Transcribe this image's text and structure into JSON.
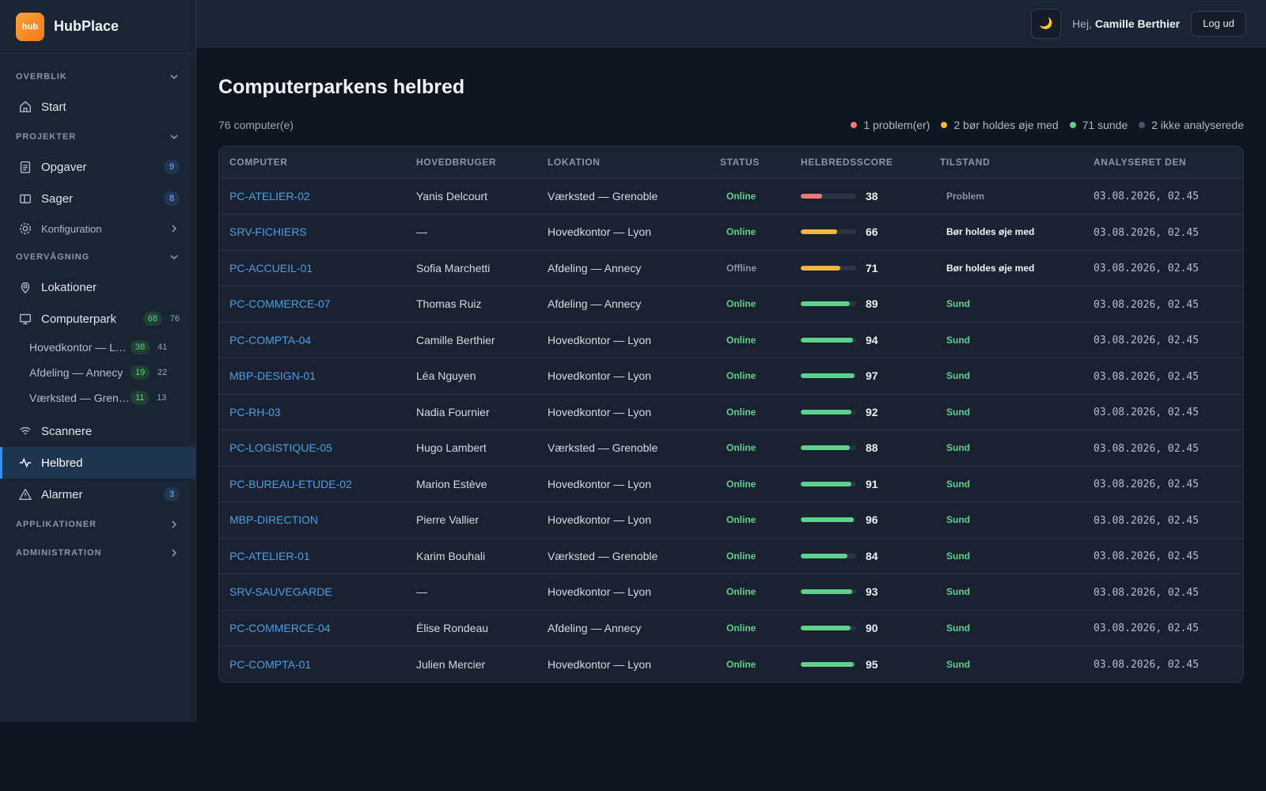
{
  "brand": {
    "logo_text": "hub",
    "name": "HubPlace"
  },
  "sidebar": {
    "sections": {
      "overblik": "OVERBLIK",
      "projekter": "PROJEKTER",
      "overvaagning": "OVERVÅGNING",
      "applikationer": "APPLIKATIONER",
      "administration": "ADMINISTRATION"
    },
    "start": "Start",
    "opgaver": {
      "label": "Opgaver",
      "badge": "9"
    },
    "sager": {
      "label": "Sager",
      "badge": "8"
    },
    "konfiguration": "Konfiguration",
    "lokationer": "Lokationer",
    "computerpark": {
      "label": "Computerpark",
      "badge": "68",
      "count": "76"
    },
    "sub": [
      {
        "label": "Hovedkontor — Lyon",
        "badge": "38",
        "count": "41"
      },
      {
        "label": "Afdeling — Annecy",
        "badge": "19",
        "count": "22"
      },
      {
        "label": "Værksted — Grenoble",
        "badge": "11",
        "count": "13"
      }
    ],
    "scannere": "Scannere",
    "helbred": "Helbred",
    "alarmer": {
      "label": "Alarmer",
      "badge": "3"
    }
  },
  "topbar": {
    "theme_glyph": "🌙",
    "greeting": "Hej,",
    "user": "Camille Berthier",
    "logout": "Log ud"
  },
  "page": {
    "title": "Computerparkens helbred",
    "total": "76 computer(e)",
    "legend": [
      {
        "label": "1 problem(er)",
        "color": "#f07a7a"
      },
      {
        "label": "2 bør holdes øje med",
        "color": "#f4b63f"
      },
      {
        "label": "71 sunde",
        "color": "#5fd18c"
      },
      {
        "label": "2 ikke analyserede",
        "color": "#4a5568"
      }
    ]
  },
  "table": {
    "headers": [
      "COMPUTER",
      "HOVEDBRUGER",
      "LOKATION",
      "STATUS",
      "HELBREDSSCORE",
      "TILSTAND",
      "ANALYSERET DEN"
    ],
    "colors": {
      "problem": "#f07a7a",
      "watch": "#f4b63f",
      "healthy": "#5fd18c"
    },
    "rows": [
      {
        "computer": "PC-ATELIER-02",
        "user": "Yanis Delcourt",
        "location": "Værksted — Grenoble",
        "status": "Online",
        "score": 38,
        "condition": "Problem",
        "level": "problem",
        "date": "03.08.2026, 02.45"
      },
      {
        "computer": "SRV-FICHIERS",
        "user": "—",
        "location": "Hovedkontor — Lyon",
        "status": "Online",
        "score": 66,
        "condition": "Bør holdes øje med",
        "level": "watch",
        "date": "03.08.2026, 02.45"
      },
      {
        "computer": "PC-ACCUEIL-01",
        "user": "Sofia Marchetti",
        "location": "Afdeling — Annecy",
        "status": "Offline",
        "score": 71,
        "condition": "Bør holdes øje med",
        "level": "watch",
        "date": "03.08.2026, 02.45"
      },
      {
        "computer": "PC-COMMERCE-07",
        "user": "Thomas Ruiz",
        "location": "Afdeling — Annecy",
        "status": "Online",
        "score": 89,
        "condition": "Sund",
        "level": "healthy",
        "date": "03.08.2026, 02.45"
      },
      {
        "computer": "PC-COMPTA-04",
        "user": "Camille Berthier",
        "location": "Hovedkontor — Lyon",
        "status": "Online",
        "score": 94,
        "condition": "Sund",
        "level": "healthy",
        "date": "03.08.2026, 02.45"
      },
      {
        "computer": "MBP-DESIGN-01",
        "user": "Léa Nguyen",
        "location": "Hovedkontor — Lyon",
        "status": "Online",
        "score": 97,
        "condition": "Sund",
        "level": "healthy",
        "date": "03.08.2026, 02.45"
      },
      {
        "computer": "PC-RH-03",
        "user": "Nadia Fournier",
        "location": "Hovedkontor — Lyon",
        "status": "Online",
        "score": 92,
        "condition": "Sund",
        "level": "healthy",
        "date": "03.08.2026, 02.45"
      },
      {
        "computer": "PC-LOGISTIQUE-05",
        "user": "Hugo Lambert",
        "location": "Værksted — Grenoble",
        "status": "Online",
        "score": 88,
        "condition": "Sund",
        "level": "healthy",
        "date": "03.08.2026, 02.45"
      },
      {
        "computer": "PC-BUREAU-ETUDE-02",
        "user": "Marion Estève",
        "location": "Hovedkontor — Lyon",
        "status": "Online",
        "score": 91,
        "condition": "Sund",
        "level": "healthy",
        "date": "03.08.2026, 02.45"
      },
      {
        "computer": "MBP-DIRECTION",
        "user": "Pierre Vallier",
        "location": "Hovedkontor — Lyon",
        "status": "Online",
        "score": 96,
        "condition": "Sund",
        "level": "healthy",
        "date": "03.08.2026, 02.45"
      },
      {
        "computer": "PC-ATELIER-01",
        "user": "Karim Bouhali",
        "location": "Værksted — Grenoble",
        "status": "Online",
        "score": 84,
        "condition": "Sund",
        "level": "healthy",
        "date": "03.08.2026, 02.45"
      },
      {
        "computer": "SRV-SAUVEGARDE",
        "user": "—",
        "location": "Hovedkontor — Lyon",
        "status": "Online",
        "score": 93,
        "condition": "Sund",
        "level": "healthy",
        "date": "03.08.2026, 02.45"
      },
      {
        "computer": "PC-COMMERCE-04",
        "user": "Élise Rondeau",
        "location": "Afdeling — Annecy",
        "status": "Online",
        "score": 90,
        "condition": "Sund",
        "level": "healthy",
        "date": "03.08.2026, 02.45"
      },
      {
        "computer": "PC-COMPTA-01",
        "user": "Julien Mercier",
        "location": "Hovedkontor — Lyon",
        "status": "Online",
        "score": 95,
        "condition": "Sund",
        "level": "healthy",
        "date": "03.08.2026, 02.45"
      }
    ]
  }
}
